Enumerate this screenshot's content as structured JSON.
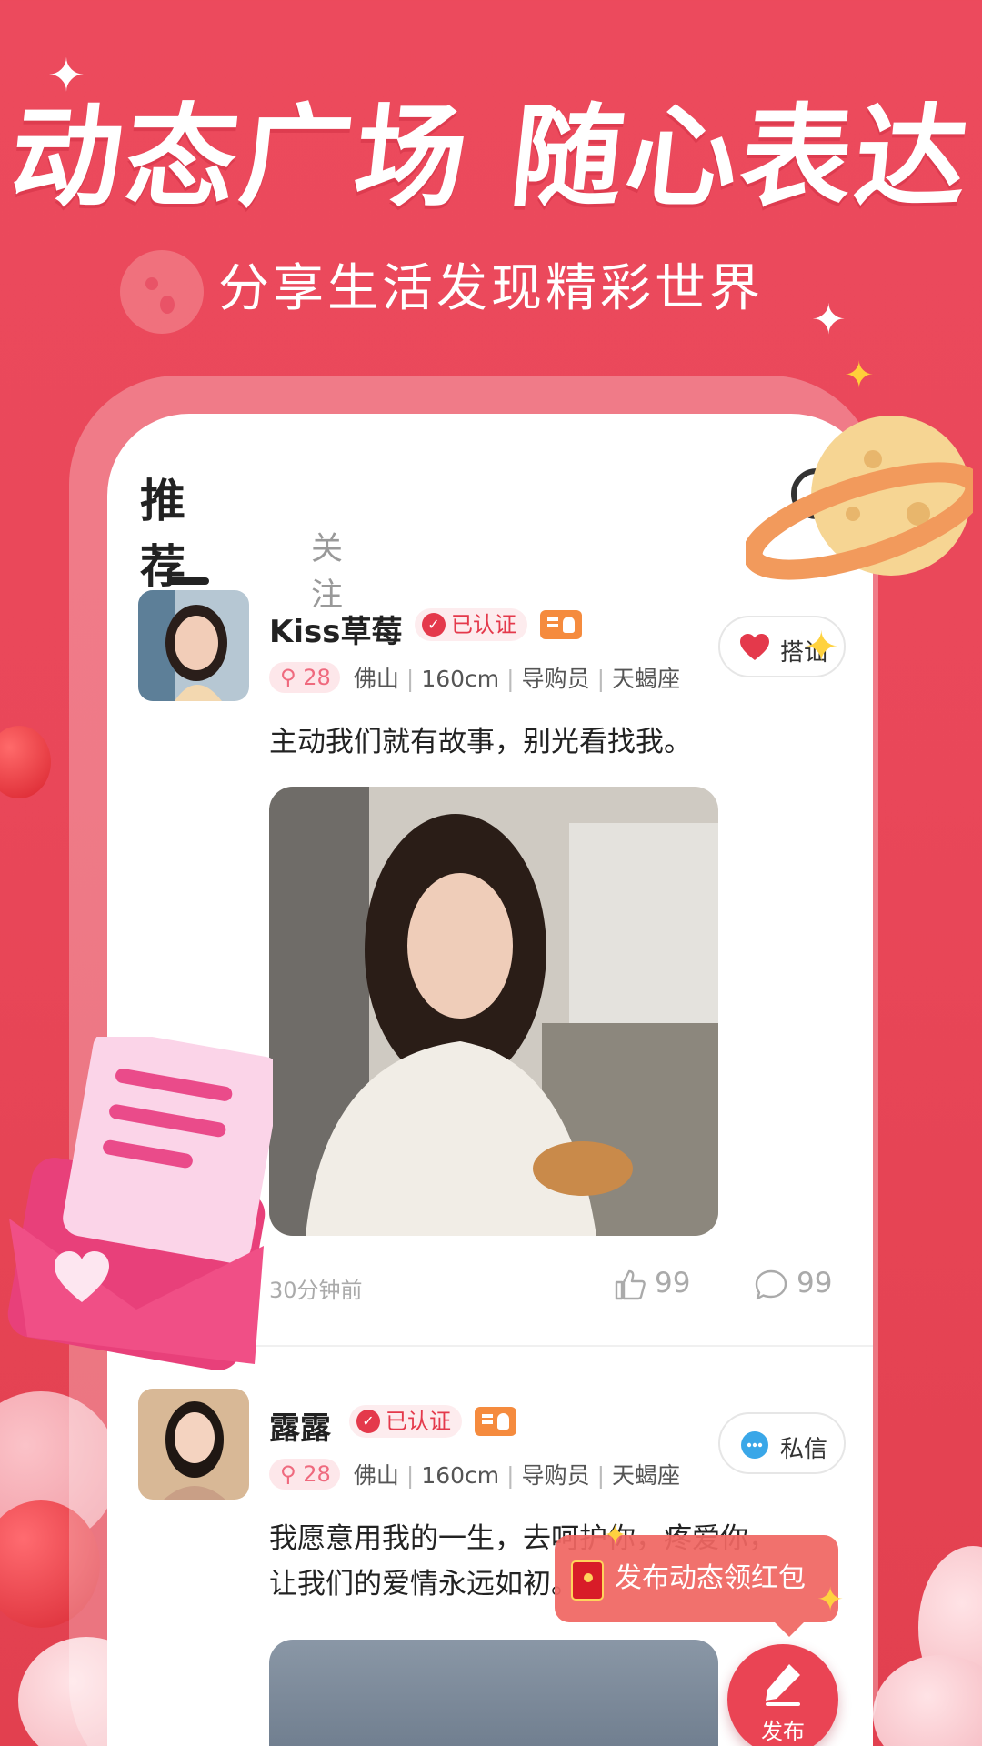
{
  "hero": {
    "title": "动态广场 随心表达",
    "subtitle": "分享生活发现精彩世界"
  },
  "tabs": {
    "recommend": "推荐",
    "follow": "关注"
  },
  "posts": [
    {
      "username": "Kiss草莓",
      "verified_label": "已认证",
      "age": "28",
      "city": "佛山",
      "height": "160cm",
      "job": "导购员",
      "zodiac": "天蝎座",
      "action_label": "搭讪",
      "action_icon": "heart-icon",
      "text": "主动我们就有故事，别光看找我。",
      "time": "30分钟前",
      "likes": "99",
      "comments": "99"
    },
    {
      "username": "露露",
      "verified_label": "已认证",
      "age": "28",
      "city": "佛山",
      "height": "160cm",
      "job": "导购员",
      "zodiac": "天蝎座",
      "action_label": "私信",
      "action_icon": "chat-bubble-icon",
      "text": "我愿意用我的一生，去呵护你，疼爱你，让我们的爱情永远如初。"
    }
  ],
  "promo": {
    "label": "发布动态领红包"
  },
  "publish": {
    "label": "发布"
  },
  "colors": {
    "brand_red": "#ea4454",
    "verified_red": "#e4394b",
    "badge_orange": "#f58b3e",
    "age_tag_pink": "#ef6a7e"
  }
}
